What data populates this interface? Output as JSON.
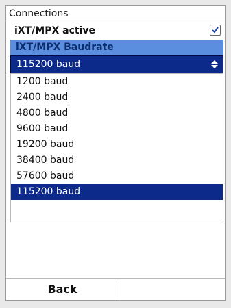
{
  "screen": {
    "title": "Connections",
    "ixt_mpx_active_label": "iXT/MPX active",
    "ixt_mpx_active_checked": true,
    "baudrate_section_label": "iXT/MPX Baudrate",
    "baudrate_selected": "115200 baud",
    "options": [
      "1200 baud",
      "2400 baud",
      "4800 baud",
      "9600 baud",
      "19200 baud",
      "38400 baud",
      "57600 baud",
      "115200 baud"
    ],
    "footer": {
      "back_label": "Back"
    }
  },
  "colors": {
    "section_bg": "#5b8ede",
    "select_bg": "#0b2a8a",
    "option_selected_bg": "#0b2a8a"
  }
}
